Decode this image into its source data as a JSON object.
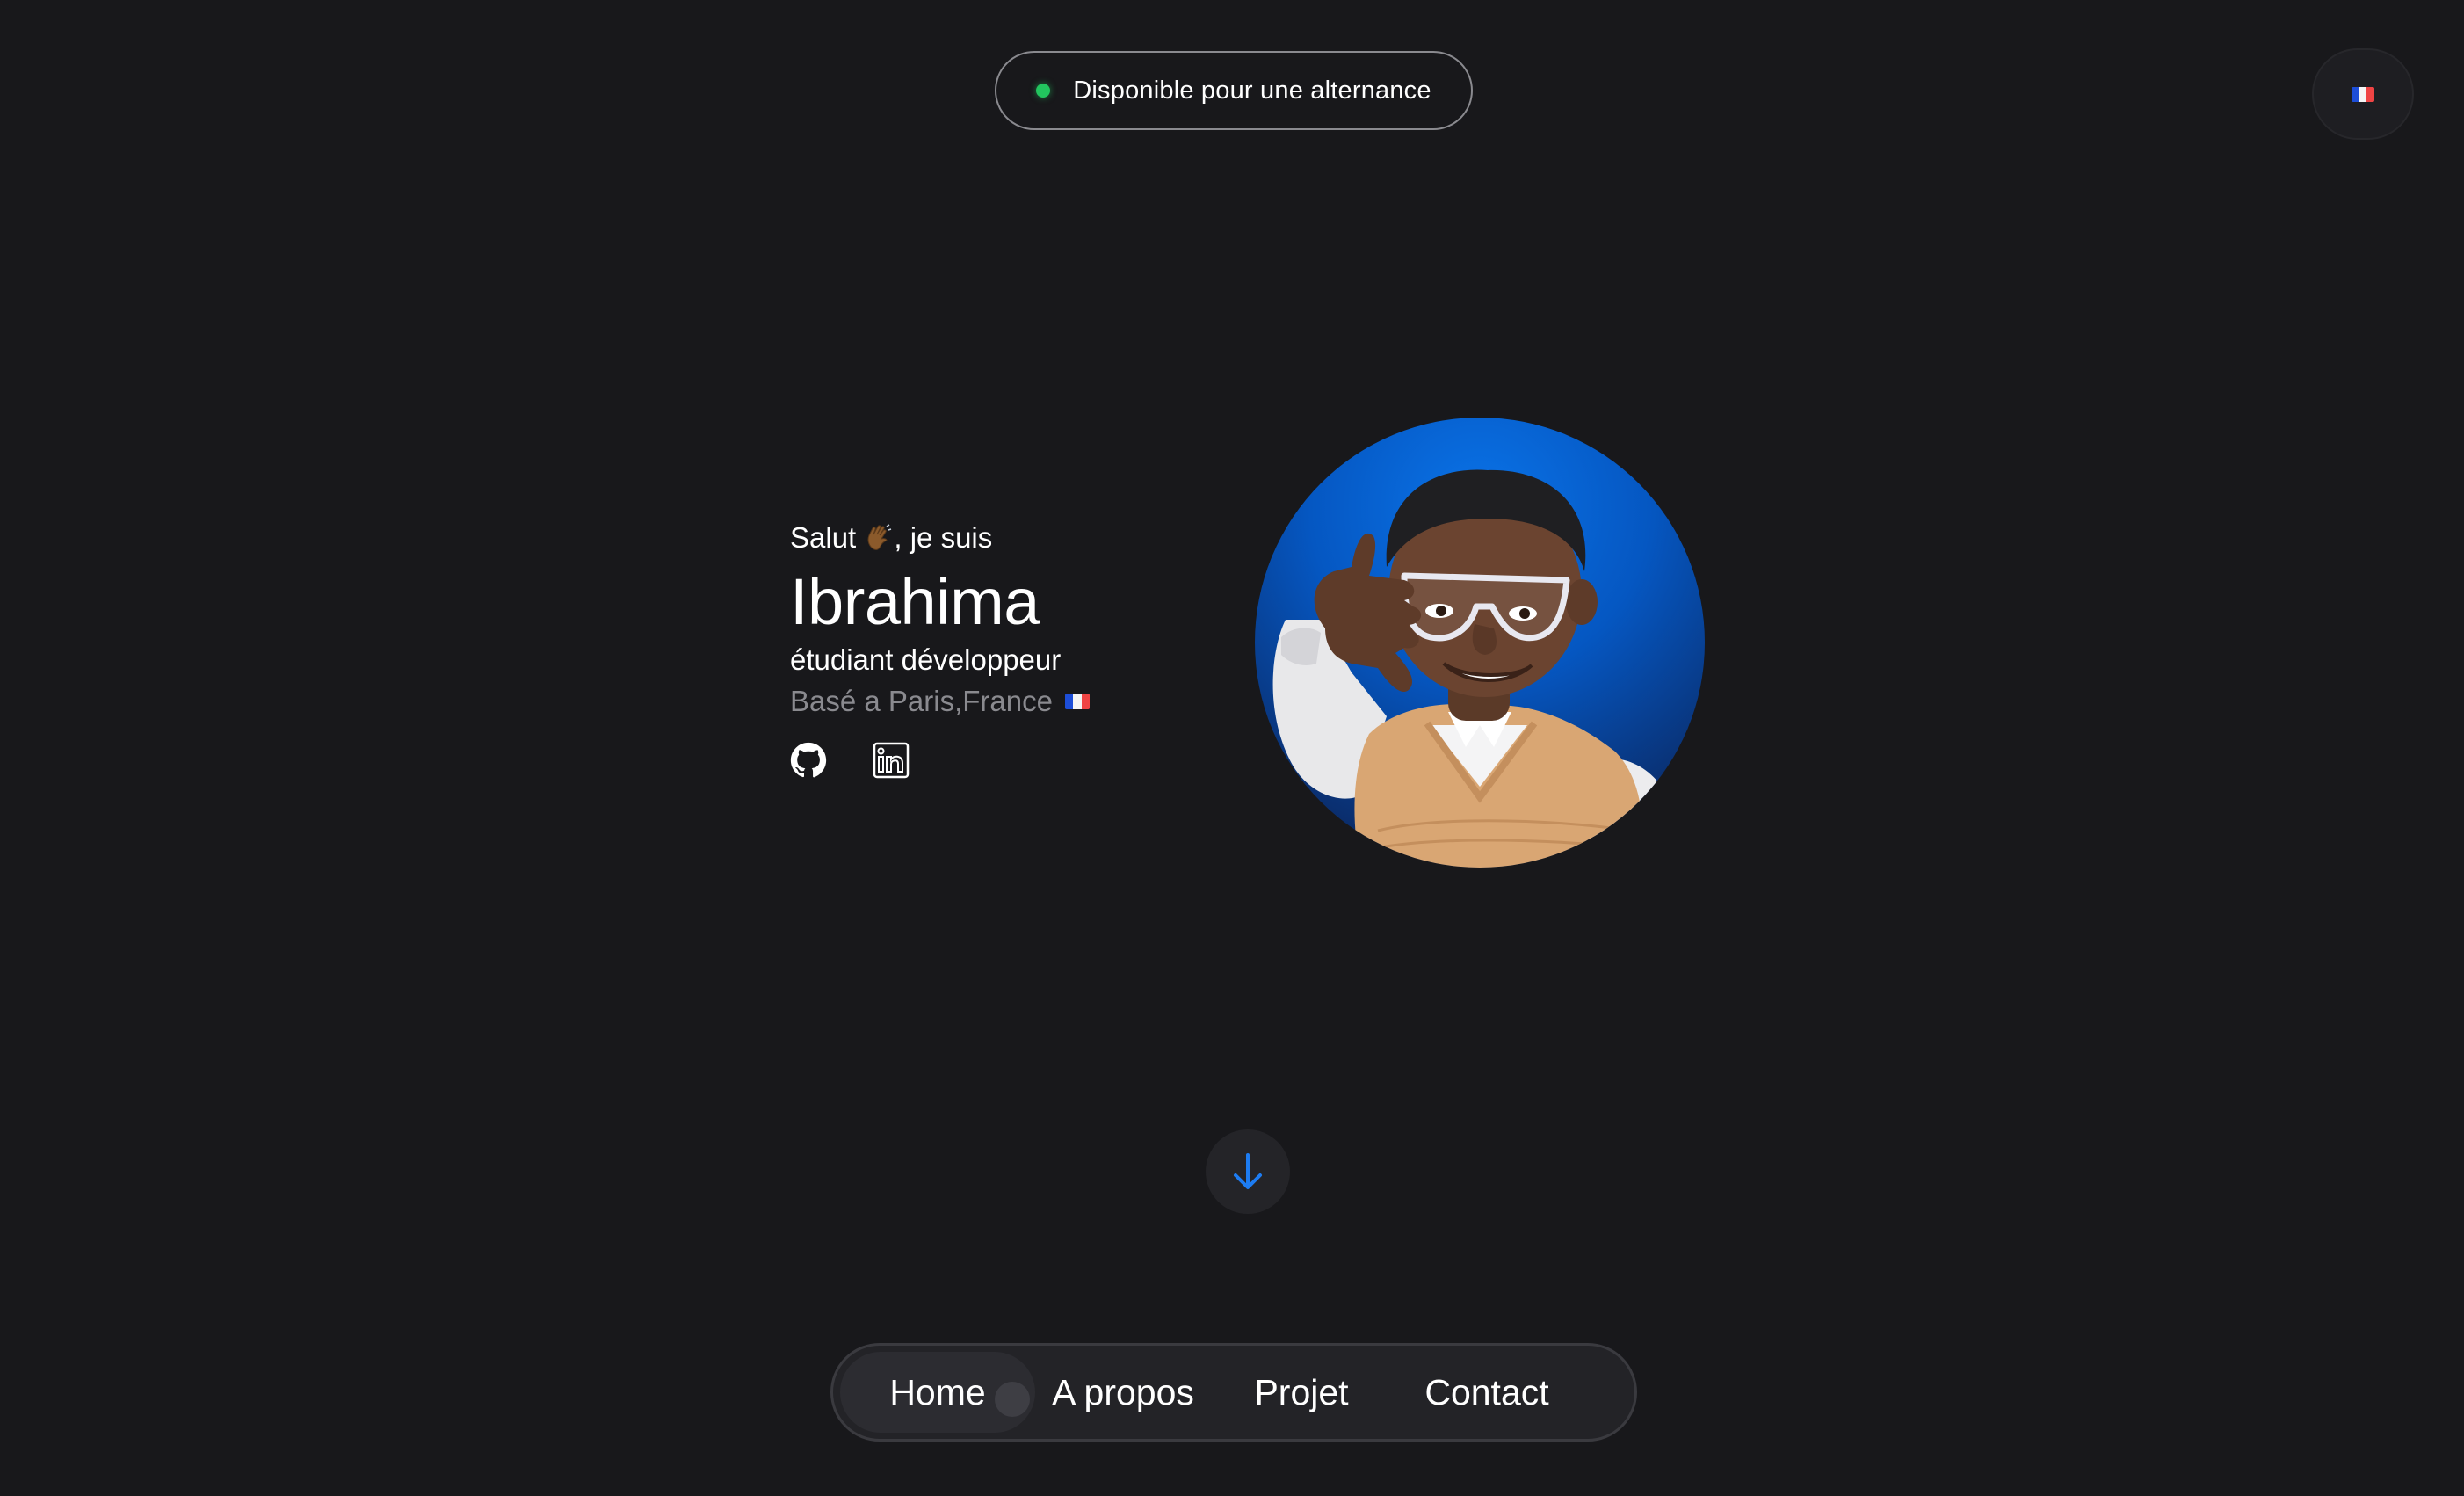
{
  "status": {
    "text": "Disponible pour une alternance",
    "dot_color": "#22c55e"
  },
  "language": {
    "current": "fr",
    "icon": "flag-fr-icon"
  },
  "hero": {
    "greeting_prefix": "Salut",
    "greeting_emoji": "waving-hand-icon",
    "greeting_suffix": ", je suis",
    "name": "Ibrahima",
    "role": "étudiant développeur",
    "location": "Basé a Paris,France",
    "location_flag": "flag-fr-icon",
    "social": [
      {
        "name": "github",
        "icon": "github-icon"
      },
      {
        "name": "linkedin",
        "icon": "linkedin-icon"
      }
    ]
  },
  "avatar": {
    "description_icon": "memoji-avatar",
    "accent": "#0a73e8"
  },
  "scroll": {
    "icon": "arrow-down-icon",
    "color": "#1d7cf2"
  },
  "nav": {
    "items": [
      {
        "label": "Home",
        "active": true
      },
      {
        "label": "A propos",
        "active": false
      },
      {
        "label": "Projet",
        "active": false
      },
      {
        "label": "Contact",
        "active": false
      }
    ]
  }
}
